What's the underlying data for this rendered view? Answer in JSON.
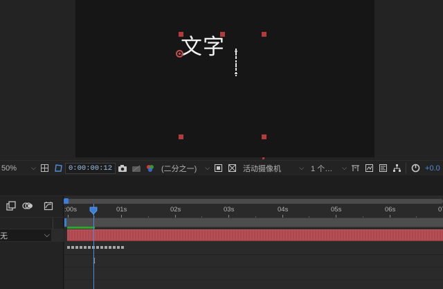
{
  "composition": {
    "text_layer": "文字"
  },
  "viewer_toolbar": {
    "magnification": "50%",
    "timecode": "0:00:00:12",
    "resolution": "(二分之一)",
    "camera_view": "活动摄像机",
    "views": "1 个…",
    "exposure": "+0.0",
    "icons": [
      "grid-guides-icon",
      "mask-shape-path-icon",
      "snapshot-icon",
      "show-snapshot-icon",
      "color-channel-icon",
      "region-of-interest-icon",
      "transparency-grid-icon",
      "fast-previews-icon",
      "timeline-icon",
      "flowchart-icon",
      "reset-exposure-icon"
    ]
  },
  "timeline": {
    "ruler_labels": [
      ":00s",
      "01s",
      "02s",
      "03s",
      "04s",
      "05s",
      "06s",
      "07"
    ],
    "parent_value": "无",
    "current_time": "0:00:00:12",
    "layer_color": "#b24a50",
    "accent_color": "#3b7ed8",
    "icons": [
      "composition-flowchart-icon",
      "motion-blur-icon",
      "graph-editor-icon"
    ]
  }
}
